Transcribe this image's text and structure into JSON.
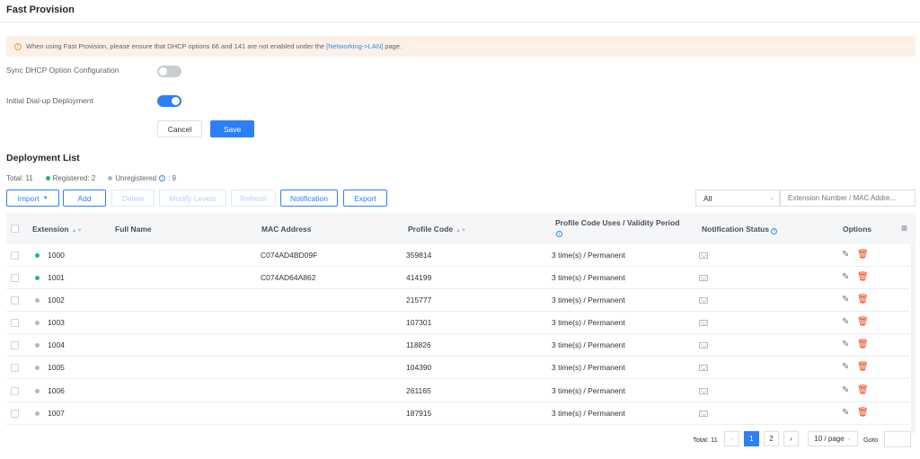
{
  "page": {
    "title": "Fast Provision"
  },
  "alert": {
    "text_before": "When using Fast Provision, please ensure that DHCP options 66 and 141 are not enabled under the",
    "link": "[Networking->LAN]",
    "text_after": "page."
  },
  "settings": {
    "sync_dhcp_label": "Sync DHCP Option Configuration",
    "sync_dhcp_on": false,
    "dialup_label": "Initial Dial-up Deployment",
    "dialup_on": true,
    "cancel_label": "Cancel",
    "save_label": "Save"
  },
  "deployment": {
    "title": "Deployment List",
    "total": "Total: 11",
    "registered": "Registered: 2",
    "unregistered": "Unregistered",
    "unregistered_count": ": 9"
  },
  "toolbar": {
    "import": "Import",
    "add": "Add",
    "delete": "Delete",
    "modify_levels": "Modify Levels",
    "refresh": "Refresh",
    "notification": "Notification",
    "export": "Export",
    "filter_value": "All",
    "search_placeholder": "Extension Number / MAC Addre..."
  },
  "table": {
    "headers": {
      "extension": "Extension",
      "full_name": "Full Name",
      "mac": "MAC Address",
      "profile_code": "Profile Code",
      "uses_line1": "Profile Code Uses / Validity Period",
      "notification_status": "Notification Status",
      "options": "Options"
    },
    "rows": [
      {
        "status": "registered",
        "extension": "1000",
        "full_name": "",
        "mac": "C074AD4BD09F",
        "code": "359814",
        "uses": "3 time(s) / Permanent"
      },
      {
        "status": "registered",
        "extension": "1001",
        "full_name": "",
        "mac": "C074AD64A862",
        "code": "414199",
        "uses": "3 time(s) / Permanent"
      },
      {
        "status": "unregistered",
        "extension": "1002",
        "full_name": "",
        "mac": "",
        "code": "215777",
        "uses": "3 time(s) / Permanent"
      },
      {
        "status": "unregistered",
        "extension": "1003",
        "full_name": "",
        "mac": "",
        "code": "107301",
        "uses": "3 time(s) / Permanent"
      },
      {
        "status": "unregistered",
        "extension": "1004",
        "full_name": "",
        "mac": "",
        "code": "118826",
        "uses": "3 time(s) / Permanent"
      },
      {
        "status": "unregistered",
        "extension": "1005",
        "full_name": "",
        "mac": "",
        "code": "104390",
        "uses": "3 time(s) / Permanent"
      },
      {
        "status": "unregistered",
        "extension": "1006",
        "full_name": "",
        "mac": "",
        "code": "261165",
        "uses": "3 time(s) / Permanent"
      },
      {
        "status": "unregistered",
        "extension": "1007",
        "full_name": "",
        "mac": "",
        "code": "187915",
        "uses": "3 time(s) / Permanent"
      }
    ]
  },
  "pagination": {
    "total": "Total: 11",
    "pages": [
      "1",
      "2"
    ],
    "current": "1",
    "page_size": "10 / page",
    "goto_label": "Goto"
  },
  "colors": {
    "primary": "#2d7ff9",
    "registered": "#19be6b",
    "unregistered": "#b5b8be",
    "delete": "#ed4014",
    "alert_bg": "#fdf0e6"
  }
}
